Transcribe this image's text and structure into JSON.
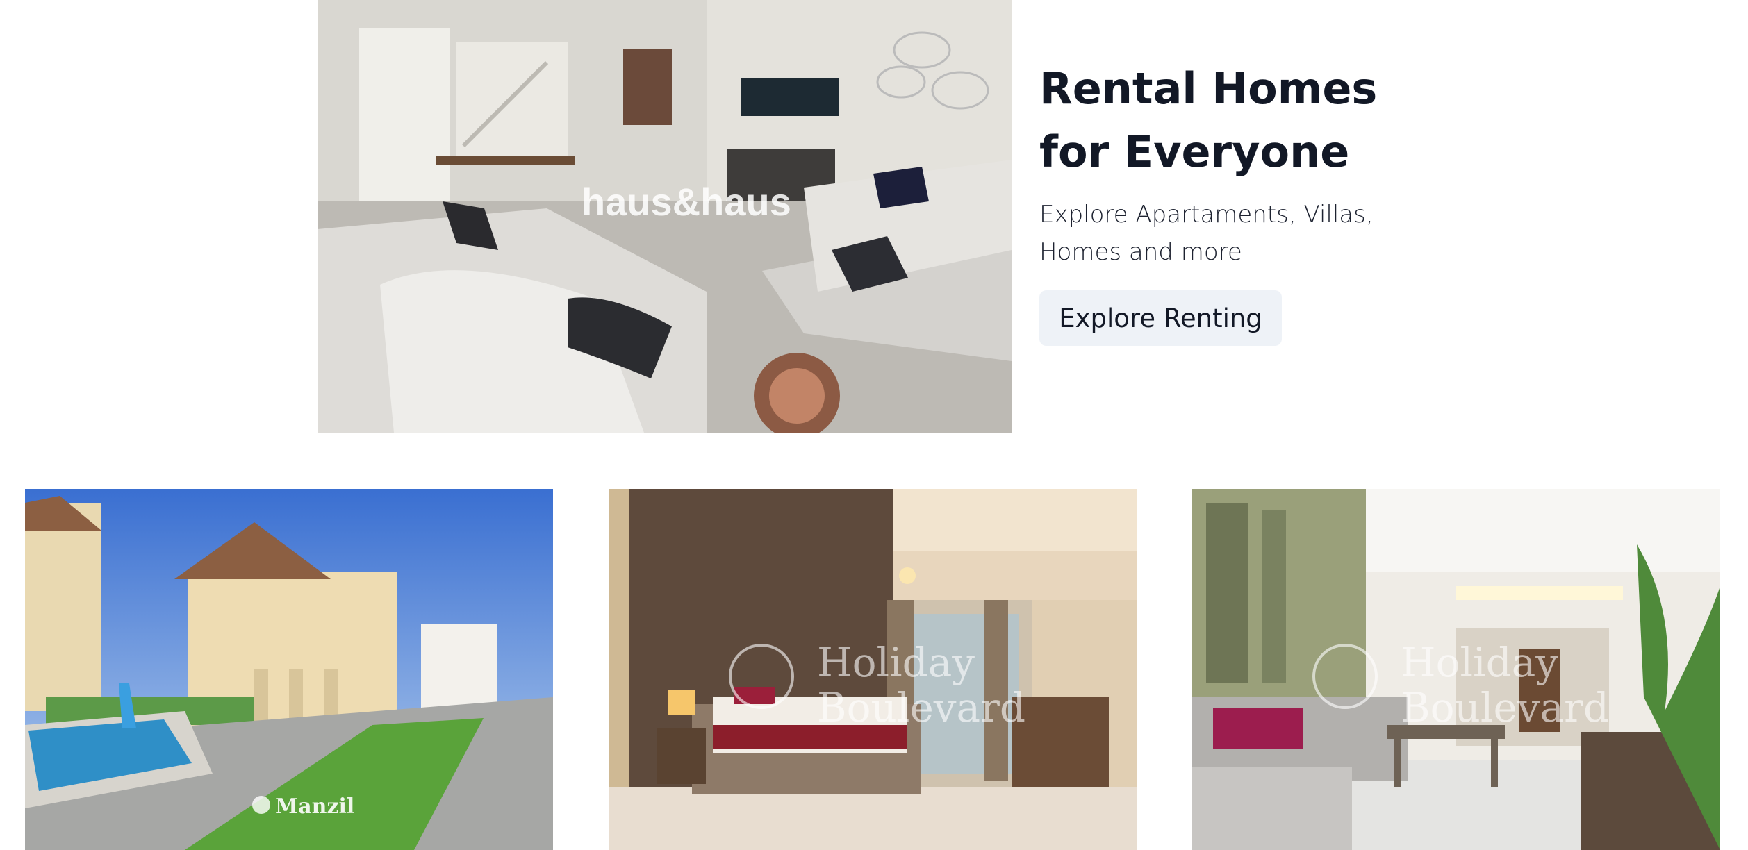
{
  "hero": {
    "title": "Rental Homes for Everyone",
    "subtitle": "Explore Apartaments, Villas, Homes and more",
    "button_label": "Explore Renting",
    "image": {
      "alt": "Living room with sectional sofa",
      "watermark": "haus&haus"
    }
  },
  "cards": [
    {
      "alt": "Villa with swimming pool and garden",
      "watermark": "Manzil"
    },
    {
      "alt": "Bedroom with balcony view",
      "watermark_line1": "Holiday",
      "watermark_line2": "Boulevard"
    },
    {
      "alt": "Open-plan living room",
      "watermark_line1": "Holiday",
      "watermark_line2": "Boulevard"
    }
  ]
}
